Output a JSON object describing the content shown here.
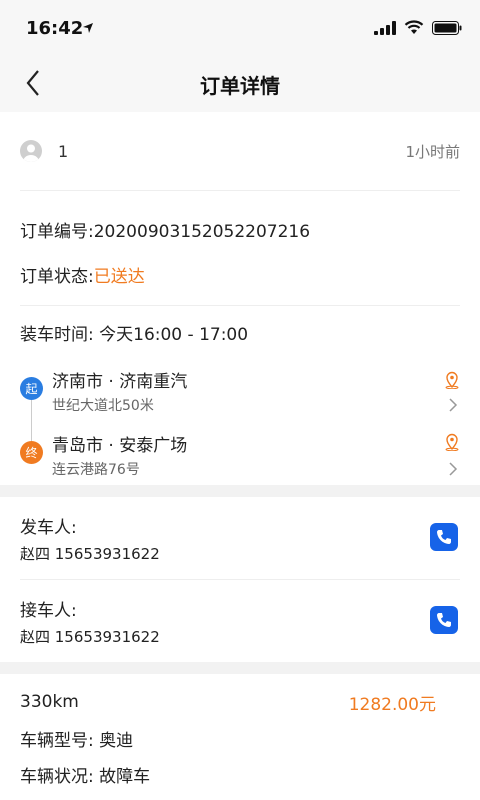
{
  "status_bar": {
    "time": "16:42"
  },
  "nav": {
    "title": "订单详情"
  },
  "user": {
    "name": "1",
    "time_ago": "1小时前"
  },
  "order": {
    "number_label": "订单编号:",
    "number": "20200903152052207216",
    "status_label": "订单状态:",
    "status": "已送达",
    "load_time": "装车时间: 今天16:00 - 17:00"
  },
  "route": {
    "start": {
      "badge": "起",
      "name": "济南市 · 济南重汽",
      "address": "世纪大道北50米"
    },
    "end": {
      "badge": "终",
      "name": "青岛市 · 安泰广场",
      "address": "连云港路76号"
    }
  },
  "sender": {
    "label": "发车人:",
    "info": "赵四 15653931622"
  },
  "receiver": {
    "label": "接车人:",
    "info": "赵四 15653931622"
  },
  "vehicle": {
    "distance": "330km",
    "price": "1282.00元",
    "model": "车辆型号: 奥迪",
    "condition": "车辆状况: 故障车"
  },
  "colors": {
    "accent_orange": "#f07b21",
    "start_blue": "#2a7de1",
    "phone_blue": "#1663e8"
  }
}
